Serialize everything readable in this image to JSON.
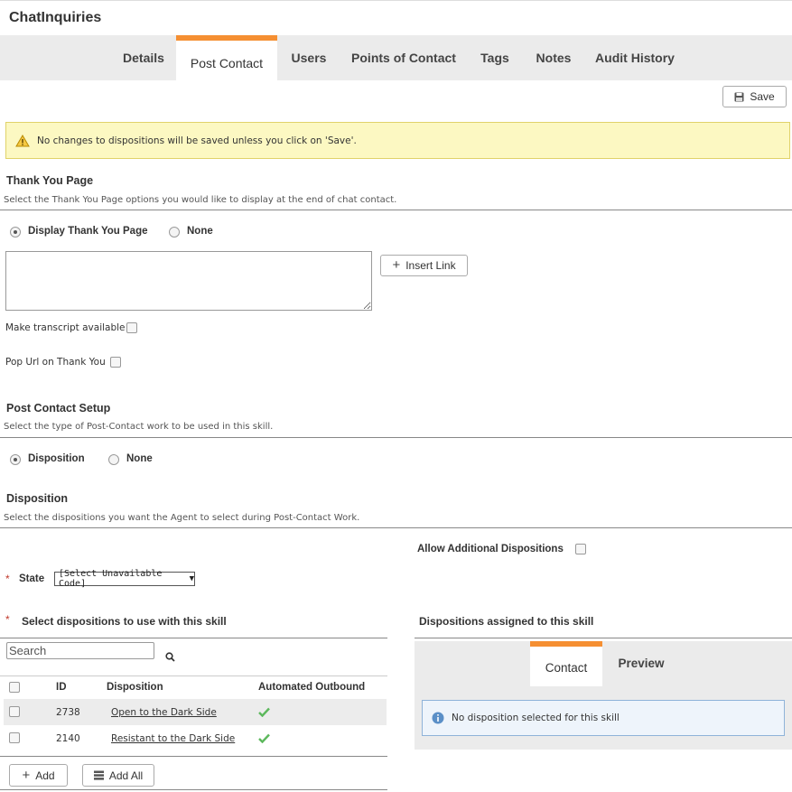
{
  "page": {
    "title": "ChatInquiries"
  },
  "tabs": [
    {
      "label": "Details"
    },
    {
      "label": "Post Contact"
    },
    {
      "label": "Users"
    },
    {
      "label": "Points of Contact"
    },
    {
      "label": "Tags"
    },
    {
      "label": "Notes"
    },
    {
      "label": "Audit History"
    }
  ],
  "active_tab": "Post Contact",
  "save_button": {
    "label": "Save",
    "icon": "floppy-disk-icon"
  },
  "alert": {
    "icon": "warning-triangle-icon",
    "text": "No changes to dispositions will be saved unless you click on 'Save'."
  },
  "thank_you": {
    "title": "Thank You Page",
    "description": "Select the Thank You Page options you would like to display at the end of chat contact.",
    "options": [
      {
        "label": "Display Thank You Page",
        "selected": true
      },
      {
        "label": "None",
        "selected": false
      }
    ],
    "text_value": "",
    "insert_link_label": "Insert Link",
    "transcript_label": "Make transcript available",
    "transcript_checked": false,
    "pop_url_label": "Pop Url on Thank You",
    "pop_url_checked": false
  },
  "post_contact": {
    "title": "Post Contact Setup",
    "description": "Select the type of Post-Contact work to be used in this skill.",
    "options": [
      {
        "label": "Disposition",
        "selected": true
      },
      {
        "label": "None",
        "selected": false
      }
    ]
  },
  "disposition": {
    "title": "Disposition",
    "description": "Select the dispositions you want the Agent to select during Post-Contact Work.",
    "allow_additional_label": "Allow Additional Dispositions",
    "allow_additional_checked": false,
    "state_label": "State",
    "state_value": "[Select Unavailable Code]",
    "required_mark": "*"
  },
  "select_list": {
    "title": "Select dispositions to use with this skill",
    "search_placeholder": "Search",
    "columns": [
      "ID",
      "Disposition",
      "Automated Outbound"
    ],
    "rows": [
      {
        "id": "2738",
        "name": "Open to the Dark Side",
        "automated": true
      },
      {
        "id": "2140",
        "name": "Resistant to the Dark Side",
        "automated": true
      }
    ],
    "add_label": "Add",
    "add_all_label": "Add All"
  },
  "assigned": {
    "title": "Dispositions assigned to this skill",
    "tabs": [
      {
        "label": "Contact"
      },
      {
        "label": "Preview"
      }
    ],
    "active_tab": "Contact",
    "empty_text": "No disposition selected for this skill"
  },
  "colors": {
    "accent": "#f58f32",
    "alert_bg": "#fcf8c2",
    "info_bg": "#eef4fb",
    "check_green": "#5cb85c",
    "required_red": "#c0392b"
  }
}
